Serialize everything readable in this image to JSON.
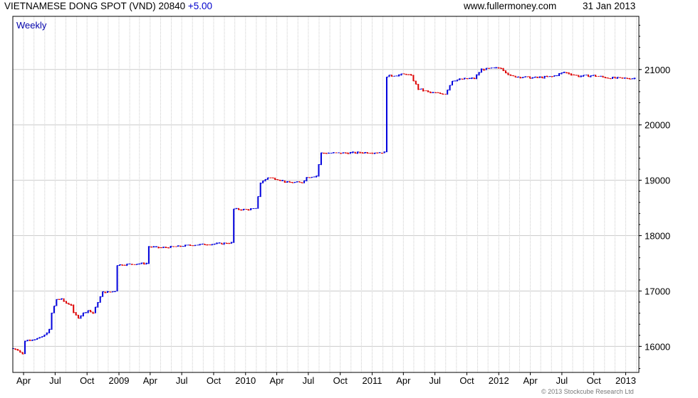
{
  "header": {
    "symbol": "VIETNAMESE DONG SPOT (VND)",
    "price": "20840",
    "change": "+5.00",
    "site": "www.fullermoney.com",
    "date": "31 Jan 2013"
  },
  "footer": "© 2013 Stockcube Research Ltd",
  "colors": {
    "up": "#0000dd",
    "down": "#dd0000",
    "grid": "#cccccc",
    "axis": "#000000",
    "label": "#0000aa"
  },
  "chart_data": {
    "type": "line",
    "period_label": "Weekly",
    "x_tick_labels": [
      "Apr",
      "Jul",
      "Oct",
      "2009",
      "Apr",
      "Jul",
      "Oct",
      "2010",
      "Apr",
      "Jul",
      "Oct",
      "2011",
      "Apr",
      "Jul",
      "Oct",
      "2012",
      "Apr",
      "Jul",
      "Oct",
      "2013"
    ],
    "y_tick_labels": [
      "16000",
      "17000",
      "18000",
      "19000",
      "20000",
      "21000"
    ],
    "y_ticks": [
      16000,
      17000,
      18000,
      19000,
      20000,
      21000
    ],
    "ylim": [
      15530,
      21960
    ],
    "x_range": [
      "2008-03-01",
      "2013-02-08"
    ],
    "grid": true,
    "series": [
      {
        "points": [
          [
            "2008-03-01",
            15960
          ],
          [
            "2008-03-15",
            15940
          ],
          [
            "2008-03-29",
            15860
          ],
          [
            "2008-04-05",
            16100
          ],
          [
            "2008-04-19",
            16120
          ],
          [
            "2008-05-03",
            16130
          ],
          [
            "2008-05-17",
            16150
          ],
          [
            "2008-05-31",
            16200
          ],
          [
            "2008-06-14",
            16300
          ],
          [
            "2008-06-21",
            16600
          ],
          [
            "2008-07-05",
            16850
          ],
          [
            "2008-07-19",
            16850
          ],
          [
            "2008-08-02",
            16780
          ],
          [
            "2008-08-16",
            16750
          ],
          [
            "2008-08-23",
            16600
          ],
          [
            "2008-09-06",
            16520
          ],
          [
            "2008-09-20",
            16600
          ],
          [
            "2008-10-04",
            16650
          ],
          [
            "2008-10-18",
            16600
          ],
          [
            "2008-11-01",
            16800
          ],
          [
            "2008-11-15",
            16980
          ],
          [
            "2008-12-06",
            16980
          ],
          [
            "2008-12-20",
            17000
          ],
          [
            "2008-12-27",
            17470
          ],
          [
            "2009-01-24",
            17480
          ],
          [
            "2009-02-21",
            17490
          ],
          [
            "2009-03-21",
            17500
          ],
          [
            "2009-03-28",
            17800
          ],
          [
            "2009-05-02",
            17780
          ],
          [
            "2009-06-13",
            17800
          ],
          [
            "2009-08-01",
            17830
          ],
          [
            "2009-10-03",
            17850
          ],
          [
            "2009-11-21",
            17870
          ],
          [
            "2009-11-28",
            18480
          ],
          [
            "2009-12-26",
            18470
          ],
          [
            "2010-01-30",
            18480
          ],
          [
            "2010-02-13",
            18950
          ],
          [
            "2010-03-06",
            19050
          ],
          [
            "2010-04-03",
            19020
          ],
          [
            "2010-05-01",
            18960
          ],
          [
            "2010-06-12",
            18960
          ],
          [
            "2010-06-26",
            19050
          ],
          [
            "2010-07-24",
            19080
          ],
          [
            "2010-08-07",
            19490
          ],
          [
            "2010-10-02",
            19490
          ],
          [
            "2010-12-04",
            19500
          ],
          [
            "2011-02-05",
            19500
          ],
          [
            "2011-02-12",
            20880
          ],
          [
            "2011-03-19",
            20900
          ],
          [
            "2011-04-09",
            20920
          ],
          [
            "2011-04-23",
            20880
          ],
          [
            "2011-05-14",
            20650
          ],
          [
            "2011-06-18",
            20580
          ],
          [
            "2011-07-30",
            20560
          ],
          [
            "2011-08-20",
            20800
          ],
          [
            "2011-09-24",
            20830
          ],
          [
            "2011-10-22",
            20840
          ],
          [
            "2011-11-12",
            21000
          ],
          [
            "2011-12-17",
            21020
          ],
          [
            "2012-01-07",
            21030
          ],
          [
            "2012-02-04",
            20880
          ],
          [
            "2012-04-07",
            20850
          ],
          [
            "2012-06-02",
            20870
          ],
          [
            "2012-07-07",
            20950
          ],
          [
            "2012-08-18",
            20880
          ],
          [
            "2012-09-29",
            20890
          ],
          [
            "2012-11-10",
            20850
          ],
          [
            "2012-12-22",
            20840
          ],
          [
            "2013-01-26",
            20840
          ]
        ]
      }
    ]
  }
}
